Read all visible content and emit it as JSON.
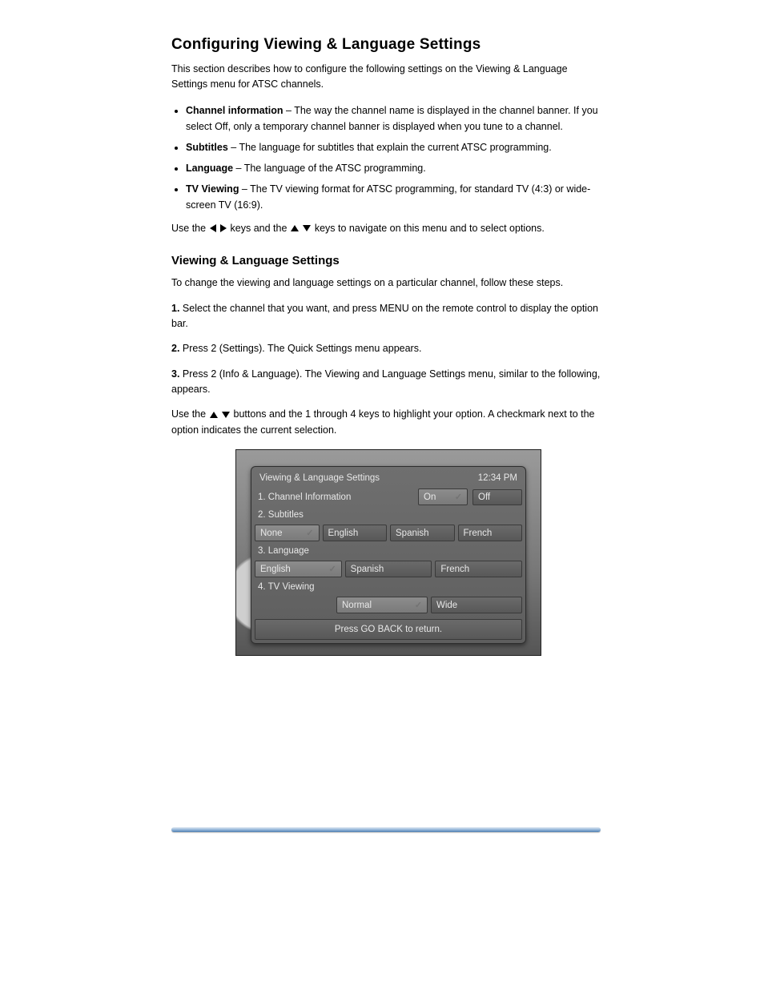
{
  "headings": {
    "h1": "Configuring Viewing & Language Settings",
    "h2": "Viewing & Language Settings"
  },
  "intro": "This section describes how to configure the following settings on the Viewing & Language Settings menu for ATSC channels.",
  "bullets": [
    {
      "term": "Channel information",
      "desc": " – The way the channel name is displayed in the channel banner. If you select Off, only a temporary channel banner is displayed when you tune to a channel."
    },
    {
      "term": "Subtitles",
      "desc": " – The language for subtitles that explain the current ATSC programming."
    },
    {
      "term": "Language",
      "desc": " – The language of the ATSC programming."
    },
    {
      "term": "TV Viewing",
      "desc": " – The TV viewing format for ATSC programming, for standard TV (4:3) or wide-screen TV (16:9)."
    }
  ],
  "midA": "Use the ",
  "midB": " keys and the ",
  "midC": " keys to navigate on this menu and to select options.",
  "stepsIntro": "To change the viewing and language settings on a particular channel, follow these steps.",
  "steps": [
    "Select the channel that you want, and press MENU on the remote control to display the option bar.",
    "Press 2 (Settings). The Quick Settings menu appears.",
    "Press 2 (Info & Language). The Viewing and Language Settings menu, similar to the following, appears."
  ],
  "contA": "Use the ",
  "contB": " buttons and the 1 through 4 keys to highlight your option. A checkmark next to the option indicates the current selection.",
  "screenshot": {
    "title": "Viewing & Language Settings",
    "time": "12:34 PM",
    "row1": {
      "label": "1.  Channel Information",
      "opts": [
        "On",
        "Off"
      ],
      "checked": 0
    },
    "row2": {
      "label": "2.  Subtitles",
      "opts": [
        "None",
        "English",
        "Spanish",
        "French"
      ],
      "checked": 0
    },
    "row3": {
      "label": "3.  Language",
      "opts": [
        "English",
        "Spanish",
        "French"
      ],
      "checked": 0
    },
    "row4": {
      "label": "4.  TV Viewing",
      "opts": [
        "Normal",
        "Wide"
      ],
      "checked": 0
    },
    "footer": "Press GO BACK to return."
  }
}
